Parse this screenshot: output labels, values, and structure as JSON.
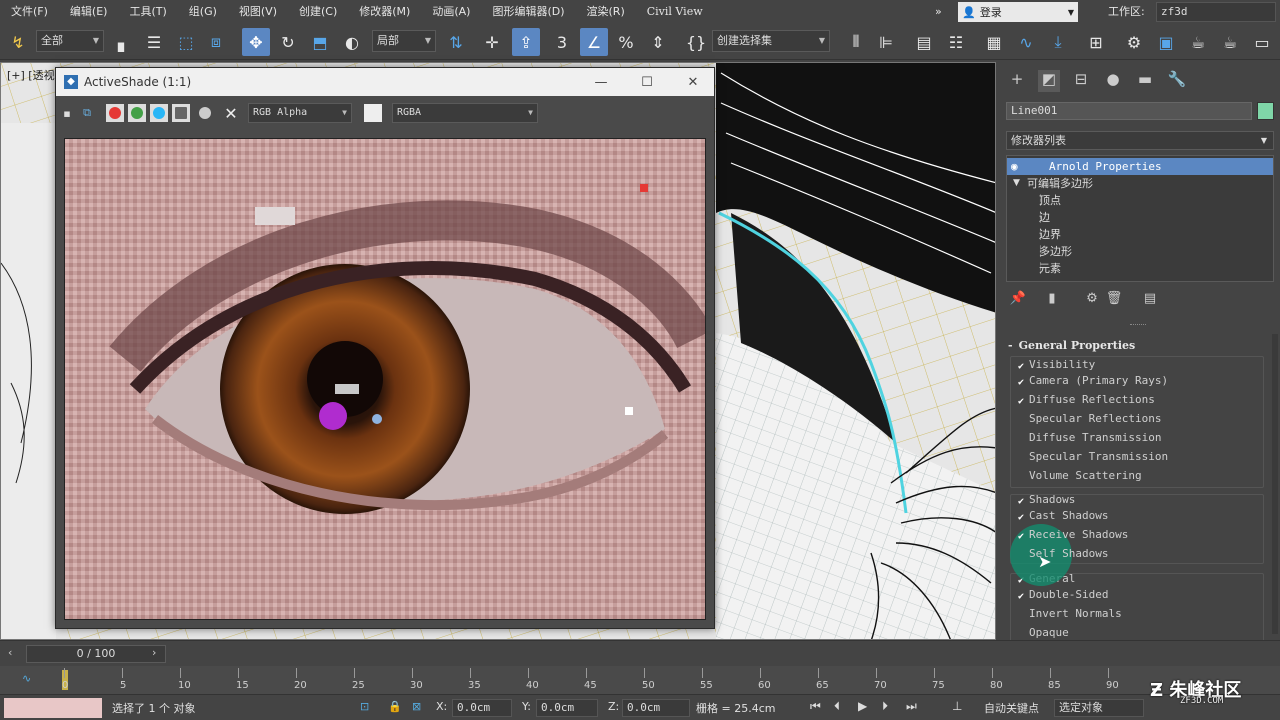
{
  "menu": [
    "文件(F)",
    "编辑(E)",
    "工具(T)",
    "组(G)",
    "视图(V)",
    "创建(C)",
    "修改器(M)",
    "动画(A)",
    "图形编辑器(D)",
    "渲染(R)",
    "Civil View"
  ],
  "login": "登录",
  "workspace_label": "工作区:",
  "workspace_value": "zf3d",
  "toolbar": {
    "filter": "全部",
    "coord_system": "局部",
    "selection_set": "创建选择集"
  },
  "viewport": {
    "label": "[+] [透视]"
  },
  "activeshade": {
    "title": "ActiveShade (1:1)",
    "channel": "RGB Alpha",
    "display": "RGBA"
  },
  "command_panel": {
    "object_name": "Line001",
    "object_color": "#7fd6a8",
    "modifier_list": "修改器列表",
    "stack": [
      {
        "label": "Arnold Properties",
        "selected": true,
        "indent": 2
      },
      {
        "label": "可编辑多边形",
        "selected": false,
        "indent": 1
      },
      {
        "label": "顶点",
        "selected": false,
        "indent": 3
      },
      {
        "label": "边",
        "selected": false,
        "indent": 3
      },
      {
        "label": "边界",
        "selected": false,
        "indent": 3
      },
      {
        "label": "多边形",
        "selected": false,
        "indent": 3
      },
      {
        "label": "元素",
        "selected": false,
        "indent": 3
      }
    ],
    "rollout_title": "General Properties",
    "visibility": [
      {
        "label": "Visibility",
        "checked": true
      },
      {
        "label": "Camera (Primary Rays)",
        "checked": true
      },
      {
        "label": "Diffuse Reflections",
        "checked": true
      },
      {
        "label": "Specular Reflections",
        "checked": false
      },
      {
        "label": "Diffuse Transmission",
        "checked": false
      },
      {
        "label": "Specular Transmission",
        "checked": false
      },
      {
        "label": "Volume Scattering",
        "checked": false
      }
    ],
    "shadows": [
      {
        "label": "Shadows",
        "checked": true
      },
      {
        "label": "Cast Shadows",
        "checked": true
      },
      {
        "label": "Receive Shadows",
        "checked": true
      },
      {
        "label": "Self Shadows",
        "checked": false
      }
    ],
    "general": [
      {
        "label": "General",
        "checked": true
      },
      {
        "label": "Double-Sided",
        "checked": true
      },
      {
        "label": "Invert Normals",
        "checked": false
      },
      {
        "label": "Opaque",
        "checked": false
      }
    ]
  },
  "timeline": {
    "frame": "0 / 100",
    "ticks": [
      "0",
      "5",
      "10",
      "15",
      "20",
      "25",
      "30",
      "35",
      "40",
      "45",
      "50",
      "55",
      "60",
      "65",
      "70",
      "75",
      "80",
      "85",
      "90"
    ]
  },
  "status": {
    "selection": "选择了 1 个 对象",
    "x_label": "X:",
    "x_value": "0.0cm",
    "y_label": "Y:",
    "y_value": "0.0cm",
    "z_label": "Z:",
    "z_value": "0.0cm",
    "grid": "栅格 = 25.4cm",
    "autokey": "自动关键点",
    "selected_object": "选定对象"
  },
  "brand": {
    "name": "朱峰社区",
    "url": "ZF3D.COM"
  }
}
